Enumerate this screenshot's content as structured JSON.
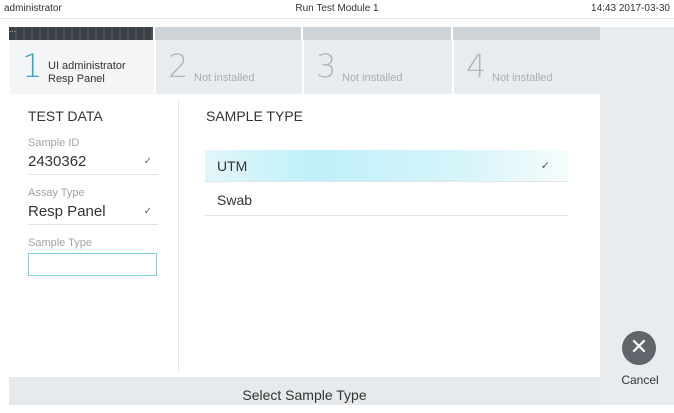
{
  "window": {
    "user": "administrator",
    "title": "Run Test Module 1",
    "datetime": "14:43 2017-03-30"
  },
  "modules": [
    {
      "number": "1",
      "line1": "UI administrator",
      "line2": "Resp Panel",
      "active": true
    },
    {
      "number": "2",
      "label": "Not installed",
      "active": false
    },
    {
      "number": "3",
      "label": "Not installed",
      "active": false
    },
    {
      "number": "4",
      "label": "Not installed",
      "active": false
    }
  ],
  "test_data": {
    "title": "TEST DATA",
    "sample_id_label": "Sample ID",
    "sample_id_value": "2430362",
    "assay_type_label": "Assay Type",
    "assay_type_value": "Resp Panel",
    "sample_type_label": "Sample Type",
    "sample_type_value": ""
  },
  "sample_type": {
    "title": "SAMPLE TYPE",
    "options": [
      {
        "label": "UTM",
        "selected": true
      },
      {
        "label": "Swab",
        "selected": false
      }
    ]
  },
  "cancel": {
    "label": "Cancel"
  },
  "footer": {
    "instruction": "Select Sample Type"
  },
  "icons": {
    "dropdown": "chevron-down-icon",
    "check": "checkmark-icon",
    "cancel": "close-icon",
    "module": "module-status-icon"
  },
  "colors": {
    "accent": "#3aa3bd",
    "selection": "#bff0fa",
    "cancel_button": "#5f656b"
  }
}
